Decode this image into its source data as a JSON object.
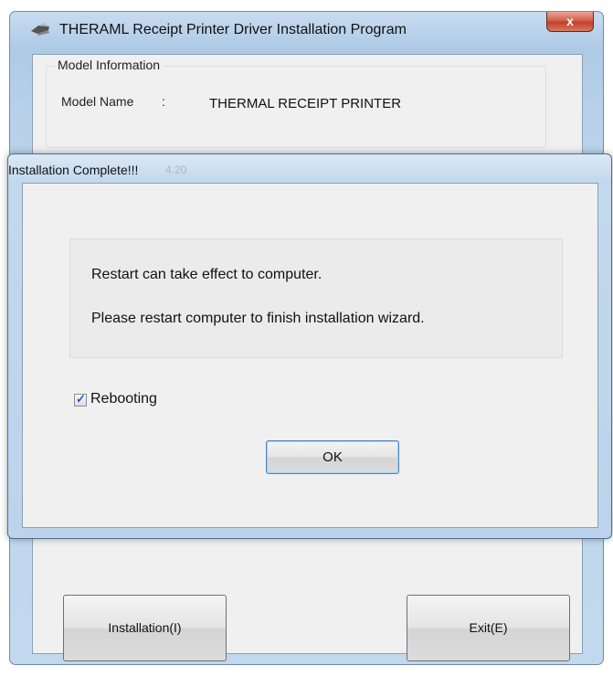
{
  "main_window": {
    "title": "THERAML Receipt Printer Driver Installation Program",
    "close_label": "x",
    "model_group_label": "Model Information",
    "model_name_label": "Model Name",
    "colon": ":",
    "model_name_value": "THERMAL RECEIPT PRINTER",
    "install_button_label": "Installation(I)",
    "exit_button_label": "Exit(E)"
  },
  "dialog": {
    "title": "Installation Complete!!!",
    "background_text": "4.20",
    "message_line_1": "Restart can take effect to computer.",
    "message_line_2": "Please restart computer to finish installation wizard.",
    "checkbox_label": "Rebooting",
    "checkbox_checked": true,
    "ok_label": "OK"
  },
  "icons": {
    "app": "printer-icon",
    "close": "close-icon",
    "check": "checkmark-icon"
  },
  "colors": {
    "title_bar": "#b9d2ea",
    "close_button": "#c2402a",
    "client_bg": "#f0f0f0"
  }
}
